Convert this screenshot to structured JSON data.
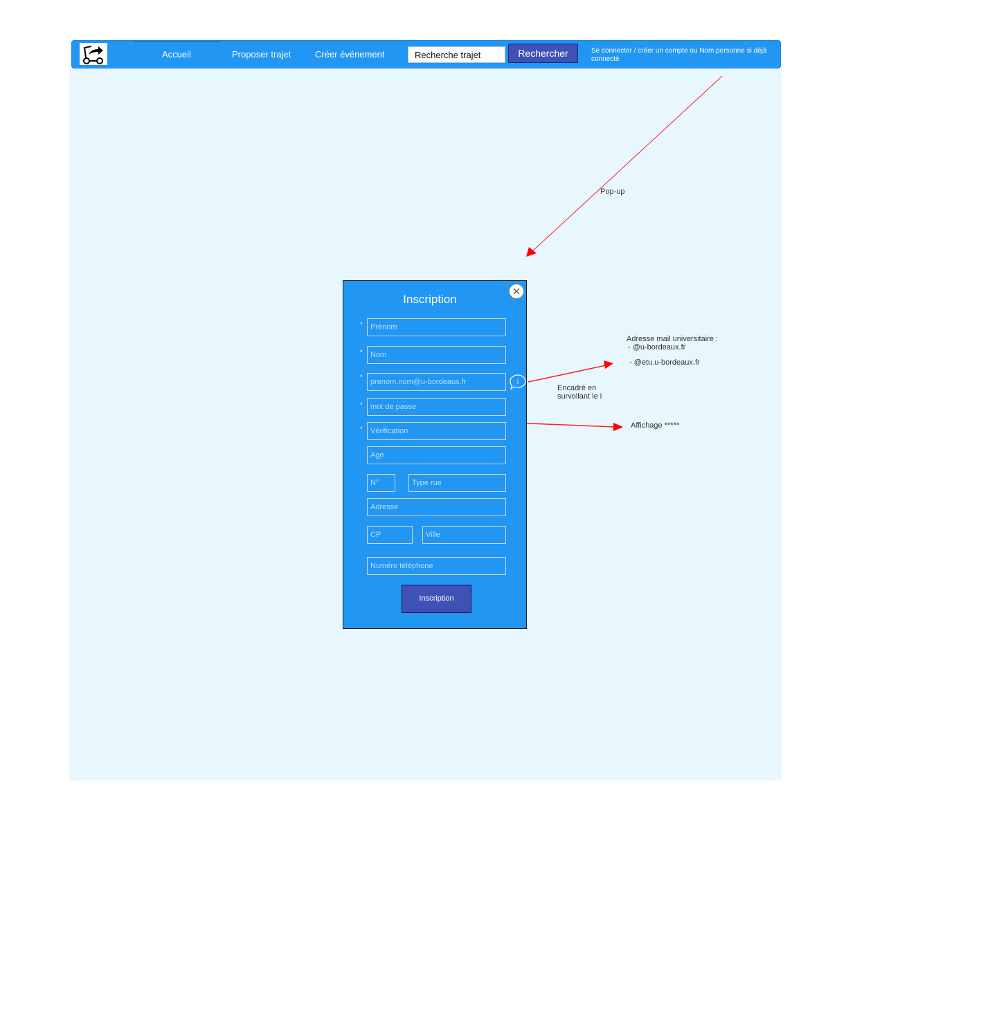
{
  "navbar": {
    "links": [
      "Accueil",
      "Proposer trajet",
      "Créer événement"
    ],
    "search": {
      "value": "Recherche trajet"
    },
    "search_button": "Rechercher",
    "login_text": "Se connecter / créer un compte ou Nom personne si déjà connecté"
  },
  "popup": {
    "title": "Inscription",
    "required_mark": "*",
    "fields": {
      "firstname": "Prénom",
      "lastname": "Nom",
      "email": "prenom.nom@u-bordeaux.fr",
      "password": "mot de passe",
      "verification": "Vérification",
      "age": "Age",
      "number": "N°",
      "street_type": "Type rue",
      "address": "Adresse",
      "postal_code": "CP",
      "city": "Ville",
      "phone": "Numéro téléphone"
    },
    "info_icon": "info-icon",
    "submit_label": "Inscription"
  },
  "annotations": {
    "popup": "Pop-up",
    "email_title": "Adresse mail universitaire :",
    "email_domain_1": "- @u-bordeaux.fr",
    "email_domain_2": "- @etu.u-bordeaux.fr",
    "hover_1": "Encadré en",
    "hover_2": "survollant le i",
    "password_display": "Affichage *****"
  },
  "colors": {
    "primary": "#2196f3",
    "button": "#3f51b5",
    "canvas": "#e8f6fd",
    "arrow": "#ff0000"
  }
}
